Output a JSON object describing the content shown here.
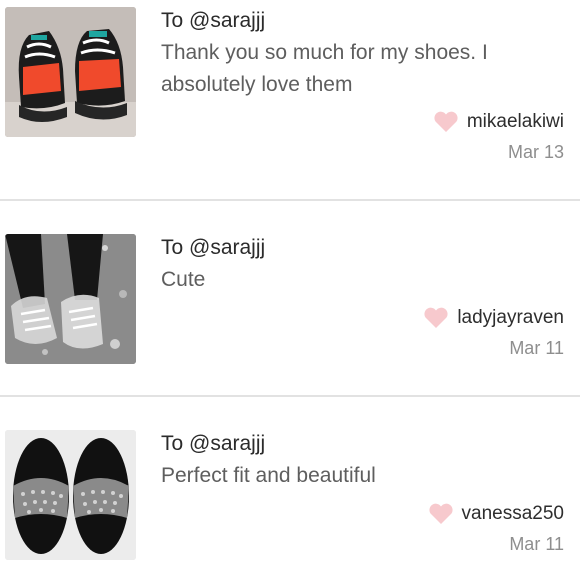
{
  "reviews": [
    {
      "to_label": "To @sarajjj",
      "message": "Thank you so much for my shoes. I absolutely love them",
      "author": "mikaelakiwi",
      "date": "Mar 13",
      "thumbnail_icon": "sneaker-thumbnail"
    },
    {
      "to_label": "To @sarajjj",
      "message": "Cute",
      "author": "ladyjayraven",
      "date": "Mar 11",
      "thumbnail_icon": "clear-sneaker-thumbnail"
    },
    {
      "to_label": "To @sarajjj",
      "message": "Perfect fit and beautiful",
      "author": "vanessa250",
      "date": "Mar 11",
      "thumbnail_icon": "slide-sandal-thumbnail"
    }
  ],
  "colors": {
    "heart": "#f7c9cd",
    "divider": "#e2e2e2",
    "message_text": "#5e5e5e",
    "date_text": "#8e8e8e"
  },
  "icons": {
    "like": "heart-icon"
  }
}
